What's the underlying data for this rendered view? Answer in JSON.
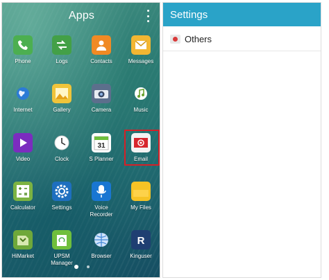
{
  "apps_drawer": {
    "title": "Apps",
    "rows": [
      [
        {
          "label": "Phone",
          "icon": "phone-icon",
          "color": "#4caf50"
        },
        {
          "label": "Logs",
          "icon": "logs-icon",
          "color": "#43a047"
        },
        {
          "label": "Contacts",
          "icon": "contacts-icon",
          "color": "#f08a24"
        },
        {
          "label": "Messages",
          "icon": "messages-icon",
          "color": "#f2b632"
        }
      ],
      [
        {
          "label": "Internet",
          "icon": "globe-icon",
          "color": "#2b7bd6"
        },
        {
          "label": "Gallery",
          "icon": "gallery-icon",
          "color": "#f0c43a"
        },
        {
          "label": "Camera",
          "icon": "camera-icon",
          "color": "#5c6f8c"
        },
        {
          "label": "Music",
          "icon": "music-icon",
          "color": "#8bc34a"
        }
      ],
      [
        {
          "label": "Video",
          "icon": "video-icon",
          "color": "#7b2cbf"
        },
        {
          "label": "Clock",
          "icon": "clock-icon",
          "color": "#f5f5f5"
        },
        {
          "label": "S Planner",
          "icon": "calendar-icon",
          "color": "#ffffff"
        },
        {
          "label": "Email",
          "icon": "email-icon",
          "color": "#f3f3f3"
        }
      ],
      [
        {
          "label": "Calculator",
          "icon": "calculator-icon",
          "color": "#7cb342"
        },
        {
          "label": "Settings",
          "icon": "settings-gear-icon",
          "color": "#1e6fbf"
        },
        {
          "label": "Voice\nRecorder",
          "icon": "voice-recorder-icon",
          "color": "#1976d2"
        },
        {
          "label": "My Files",
          "icon": "folder-icon",
          "color": "#f6c325"
        }
      ],
      [
        {
          "label": "HiMarket",
          "icon": "himarket-icon",
          "color": "#6fa83a"
        },
        {
          "label": "UPSM\nManager",
          "icon": "upsm-manager-icon",
          "color": "#6fbf3c"
        },
        {
          "label": "Browser",
          "icon": "browser-icon",
          "color": "#3f86d6"
        },
        {
          "label": "Kinguser",
          "icon": "kinguser-icon",
          "color": "#1f3f72"
        }
      ]
    ],
    "highlighted_app": "Email",
    "highlight_color": "#d71f26",
    "page_indicator": {
      "pages": 2,
      "current": 1
    }
  },
  "settings": {
    "title": "Settings",
    "header_color": "#2aa3c8",
    "items": [
      {
        "label": "Others",
        "icon": "others-icon"
      }
    ]
  }
}
